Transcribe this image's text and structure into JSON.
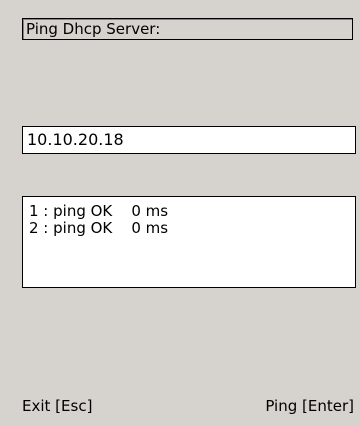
{
  "header": {
    "title": "Ping Dhcp Server:"
  },
  "ip_field": {
    "value": "10.10.20.18"
  },
  "results": [
    {
      "text": "1 : ping OK    0 ms"
    },
    {
      "text": "2 : ping OK    0 ms"
    }
  ],
  "softkeys": {
    "left_label": "Exit [Esc]",
    "right_label": "Ping [Enter]"
  }
}
